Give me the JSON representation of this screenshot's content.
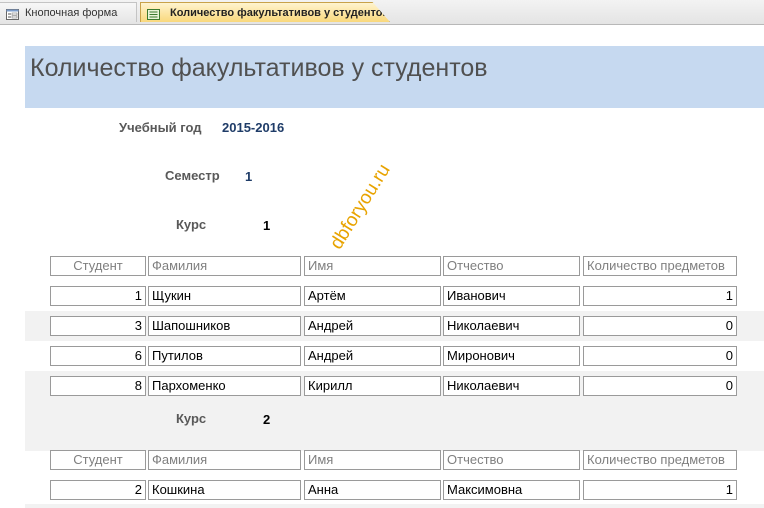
{
  "tabs": [
    {
      "label": "Кнопочная форма"
    },
    {
      "label": "Количество факультативов у студентов"
    }
  ],
  "report": {
    "title": "Количество факультативов у студентов",
    "year_label": "Учебный год",
    "year_value": "2015-2016",
    "semester_label": "Семестр",
    "semester_value": "1"
  },
  "columns": [
    "Студент",
    "Фамилия",
    "Имя",
    "Отчество",
    "Количество предметов"
  ],
  "groups": [
    {
      "course_label": "Курс",
      "course_value": "1",
      "rows": [
        {
          "student": "1",
          "last": "Щукин",
          "first": "Артём",
          "middle": "Иванович",
          "count": "1"
        },
        {
          "student": "3",
          "last": "Шапошников",
          "first": "Андрей",
          "middle": "Николаевич",
          "count": "0"
        },
        {
          "student": "6",
          "last": "Путилов",
          "first": "Андрей",
          "middle": "Миронович",
          "count": "0"
        },
        {
          "student": "8",
          "last": "Пархоменко",
          "first": "Кирилл",
          "middle": "Николаевич",
          "count": "0"
        }
      ]
    },
    {
      "course_label": "Курс",
      "course_value": "2",
      "rows": [
        {
          "student": "2",
          "last": "Кошкина",
          "first": "Анна",
          "middle": "Максимовна",
          "count": "1"
        }
      ]
    }
  ],
  "watermark": "dbforyou.ru",
  "colors": {
    "header_band": "#c6d9f0",
    "active_tab": "#f9d87c",
    "alt_row": "#f2f2f2",
    "watermark": "#e8a300"
  },
  "icons": {
    "tab1": "form-icon",
    "tab2": "report-icon",
    "close": "close-icon"
  }
}
